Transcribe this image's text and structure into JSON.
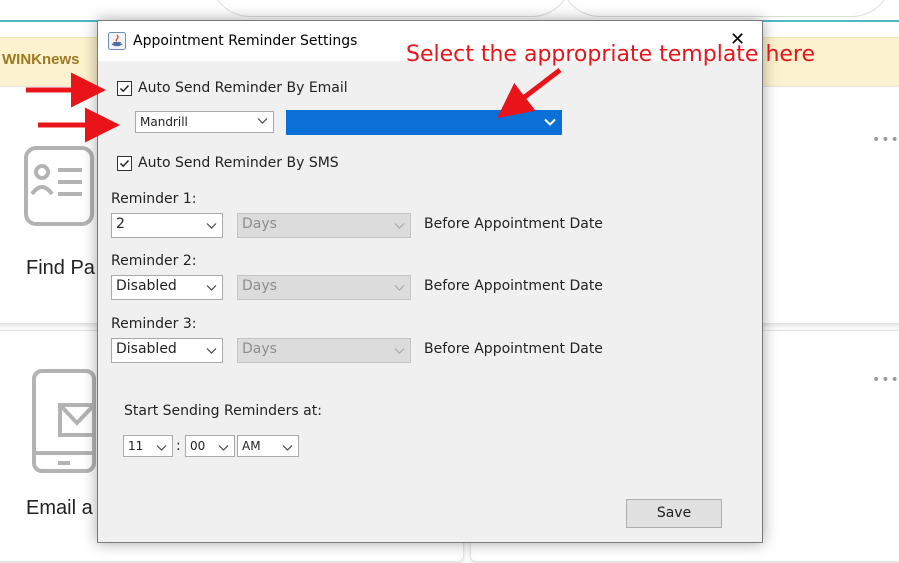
{
  "background": {
    "banner_text": "WINKnews",
    "card_titles": [
      "Find Pa",
      "Email a"
    ],
    "more_label": "•••"
  },
  "dialog": {
    "title": "Appointment Reminder Settings",
    "close_glyph": "✕",
    "email": {
      "label": "Auto Send Reminder By Email",
      "checked": true,
      "provider": "Mandrill",
      "template": ""
    },
    "sms": {
      "label": "Auto Send Reminder By SMS",
      "checked": true
    },
    "reminders": [
      {
        "label": "Reminder 1:",
        "value": "2",
        "unit": "Days",
        "suffix": "Before Appointment Date"
      },
      {
        "label": "Reminder 2:",
        "value": "Disabled",
        "unit": "Days",
        "suffix": "Before Appointment Date"
      },
      {
        "label": "Reminder 3:",
        "value": "Disabled",
        "unit": "Days",
        "suffix": "Before Appointment Date"
      }
    ],
    "start_time": {
      "label": "Start Sending Reminders at:",
      "hour": "11",
      "separator": ":",
      "minute": "00",
      "ampm": "AM"
    },
    "save_label": "Save"
  },
  "annotation": {
    "text": "Select the appropriate template here",
    "color": "#e8141a"
  },
  "colors": {
    "accent_teal": "#4fb8c4",
    "banner_bg": "#fdf2cf",
    "template_selected": "#0a6fd6"
  }
}
